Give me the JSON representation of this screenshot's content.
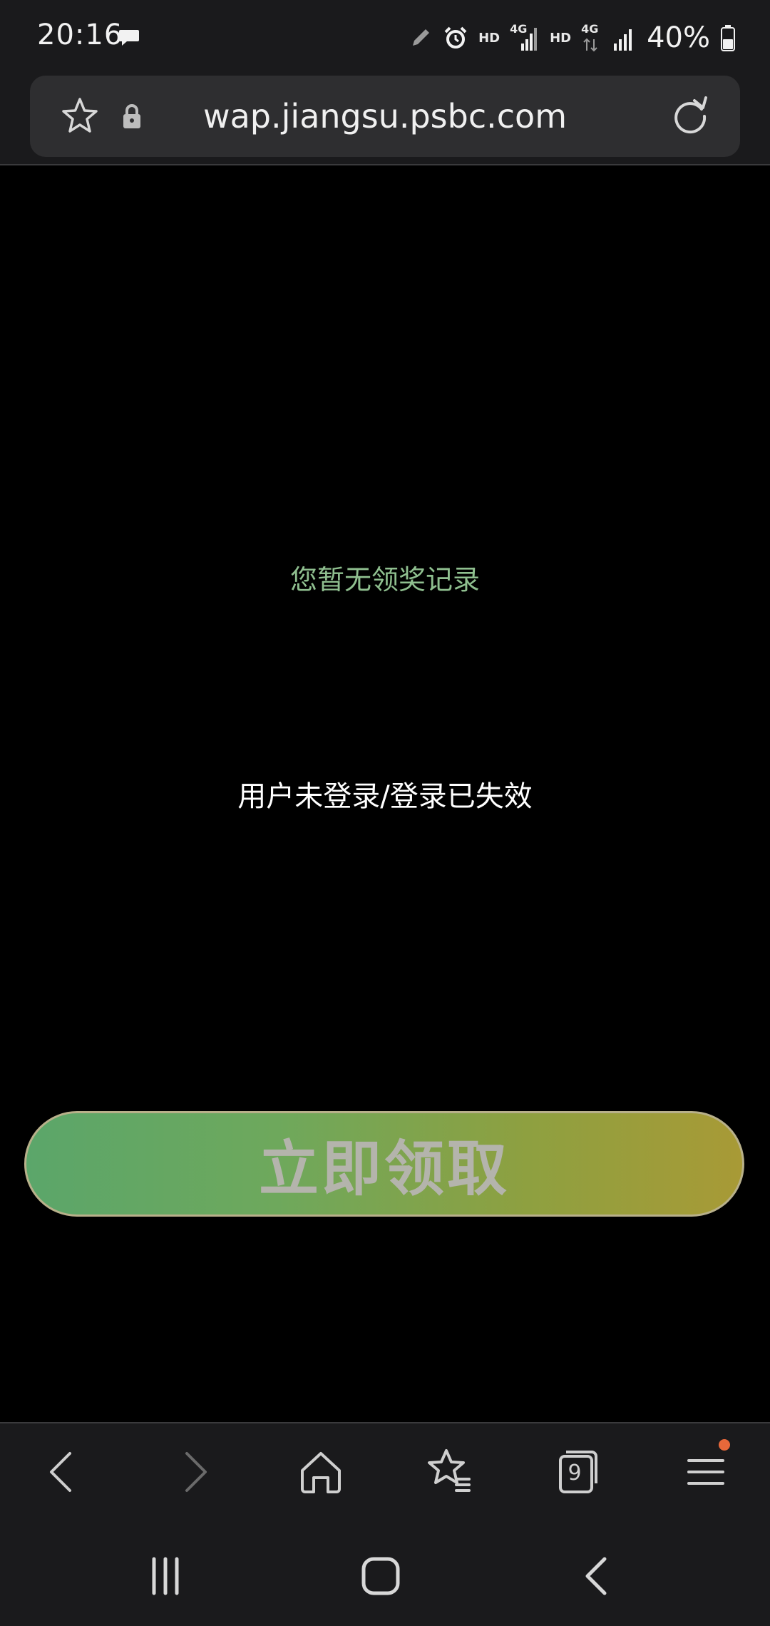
{
  "status_bar": {
    "time": "20:16",
    "hd1": "HD",
    "net1": "4G",
    "hd2": "HD",
    "net2": "4G",
    "battery": "40%"
  },
  "url_bar": {
    "url": "wap.jiangsu.psbc.com"
  },
  "content": {
    "no_record_text": "您暂无领奖记录",
    "login_message": "用户未登录/登录已失效",
    "claim_button_label": "立即领取"
  },
  "toolbar": {
    "tab_count": "9"
  },
  "colors": {
    "status_text": "#f2f2f2",
    "no_record_text": "#8fbf8f",
    "button_gradient_start": "#5ba66a",
    "button_gradient_end": "#a89a36",
    "notification_dot": "#e8683a"
  }
}
